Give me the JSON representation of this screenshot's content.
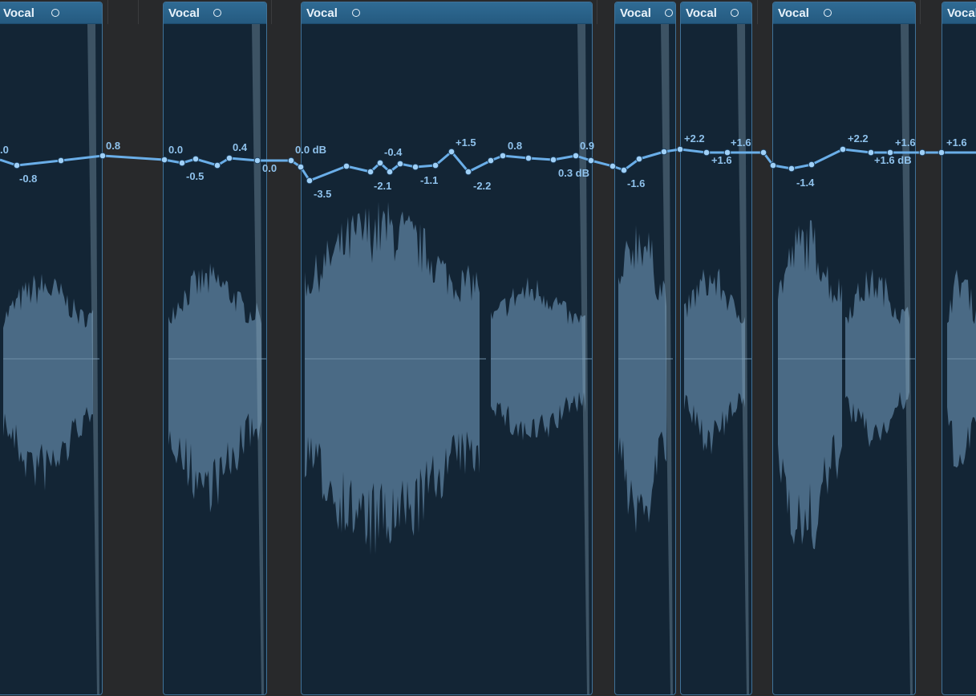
{
  "regions": [
    {
      "name": "Vocal"
    },
    {
      "name": "Vocal"
    },
    {
      "name": "Vocal"
    },
    {
      "name": "Vocal"
    },
    {
      "name": "Vocal"
    },
    {
      "name": "Vocal"
    },
    {
      "name": "Vocal"
    }
  ],
  "automation_labels": [
    ".0",
    "-0.8",
    "0.8",
    "0.0",
    "-0.5",
    "0.4",
    "0.0",
    "0.0 dB",
    "-3.5",
    "-0.4",
    "-2.1",
    "-1.1",
    "+1.5",
    "-2.2",
    "0.8",
    "0.9",
    "0.3 dB",
    "-1.6",
    "+2.2",
    "+1.6",
    "+1.6",
    "-1.4",
    "+2.2",
    "+1.6",
    "+1.6 dB",
    "+1.6"
  ],
  "colors": {
    "background": "#28292b",
    "region_fill": "#132535",
    "region_header": "#2f6b94",
    "waveform": "#4a6a85",
    "automation_line": "#6aaee8"
  }
}
